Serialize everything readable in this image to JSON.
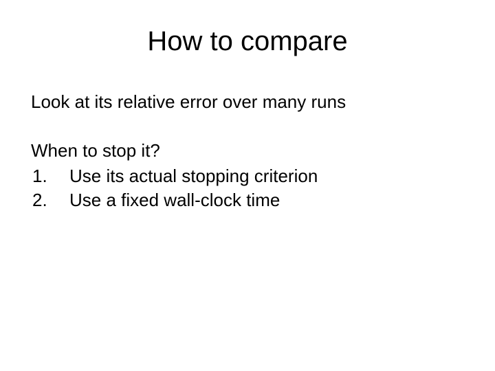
{
  "slide": {
    "title": "How to compare",
    "intro": "Look at its relative error over many runs",
    "question": "When to stop it?",
    "list": {
      "item1": "Use its actual stopping criterion",
      "item2": "Use a fixed wall-clock time"
    }
  }
}
